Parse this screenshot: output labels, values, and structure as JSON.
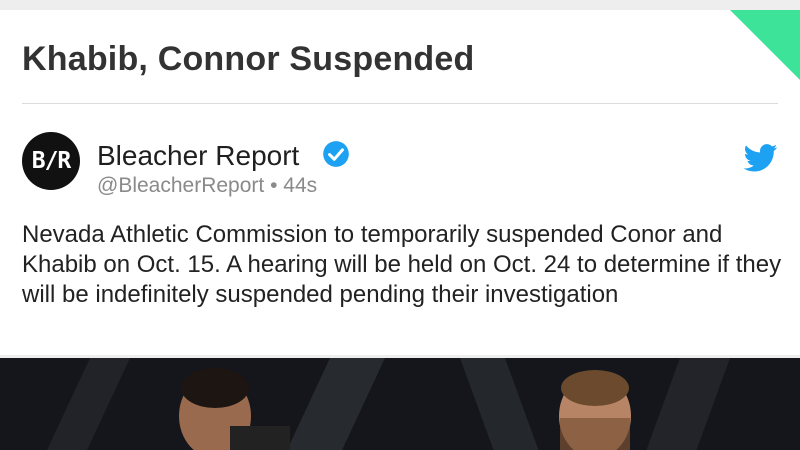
{
  "headline": "Khabib, Connor Suspended",
  "tweet": {
    "avatar_text": "B/R",
    "author_name": "Bleacher Report",
    "verified_icon": "verified-badge-icon",
    "handle": "@BleacherReport",
    "separator": "•",
    "time": "44s",
    "platform_icon": "twitter-bird-icon",
    "text": "Nevada Athletic Commission to temporarily suspended Conor and Khabib on Oct. 15. A hearing will be held on Oct. 24 to determine if they will be indefinitely suspended pending their investigation"
  },
  "colors": {
    "accent_corner": "#3ee39a",
    "twitter_blue": "#1da1f2",
    "headline_text": "#333333"
  }
}
